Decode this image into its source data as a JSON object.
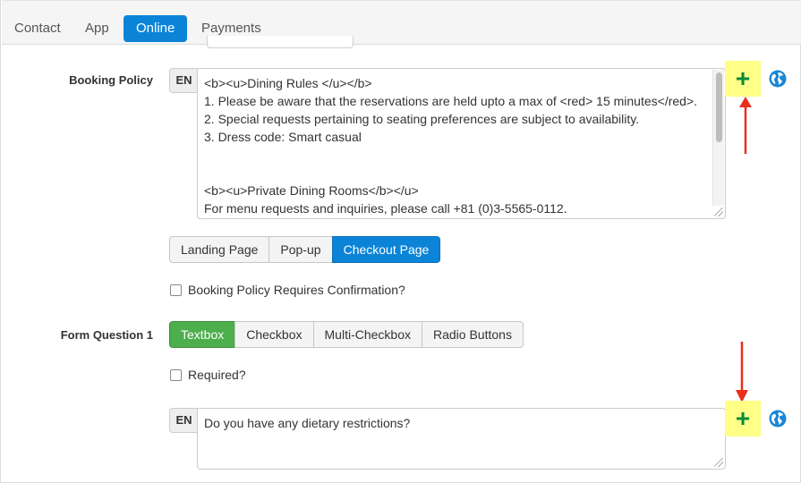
{
  "tabs": [
    {
      "label": "Contact",
      "active": false
    },
    {
      "label": "App",
      "active": false
    },
    {
      "label": "Online",
      "active": true
    },
    {
      "label": "Payments",
      "active": false
    }
  ],
  "booking_policy": {
    "label": "Booking Policy",
    "lang": "EN",
    "text_lines": [
      "<b><u>Dining Rules </u></b>",
      "1. Please be aware that the reservations are held upto a max of <red> 15 minutes</red>.",
      "2. Special requests pertaining to seating preferences are subject to availability.",
      "3. Dress code: Smart casual",
      "",
      "",
      "<b><u>Private Dining Rooms</b></u>",
      "For menu requests and inquiries, please call +81 (0)3-5565-0112."
    ],
    "placement_buttons": [
      "Landing Page",
      "Pop-up",
      "Checkout Page"
    ],
    "placement_selected": "Checkout Page",
    "confirmation_label": "Booking Policy Requires Confirmation?"
  },
  "form_question_1": {
    "label": "Form Question 1",
    "type_buttons": [
      "Textbox",
      "Checkbox",
      "Multi-Checkbox",
      "Radio Buttons"
    ],
    "type_selected": "Textbox",
    "required_label": "Required?",
    "lang": "EN",
    "question_text": "Do you have any dietary restrictions?"
  },
  "icons": {
    "add": "plus-icon",
    "translate": "globe-icon",
    "annotation": "red-arrow"
  },
  "colors": {
    "accent_blue": "#0b84d8",
    "success_green": "#4cae4c",
    "plus_green": "#0a8a3a",
    "highlight_yellow": "#ffff88",
    "arrow_red": "#e8301c"
  }
}
